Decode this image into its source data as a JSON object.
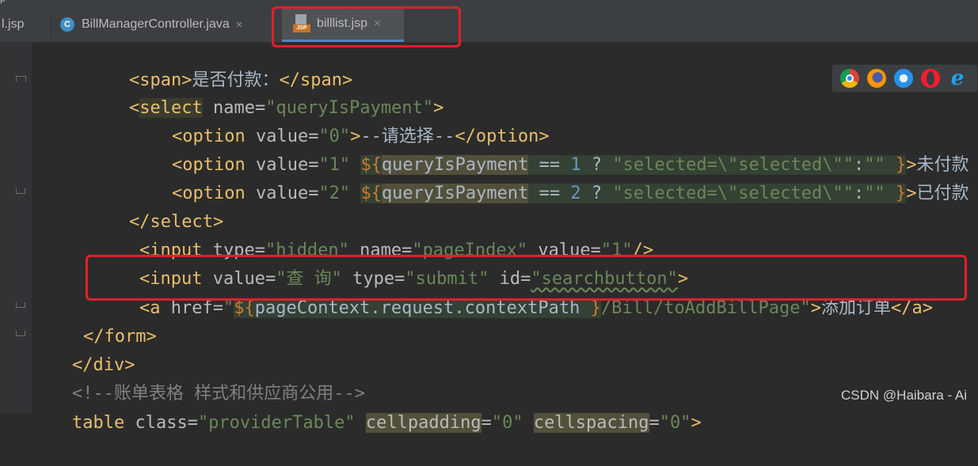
{
  "window": {
    "top_strip_text": "p"
  },
  "tabs": [
    {
      "label": "l.jsp",
      "icon": "jsp-file-icon",
      "active": false
    },
    {
      "label": "BillManagerController.java",
      "icon": "java-class-icon",
      "icon_letter": "C",
      "active": false
    },
    {
      "label": "billlist.jsp",
      "icon": "jsp-file-icon",
      "icon_badge": "JSP",
      "active": true
    }
  ],
  "close_glyph": "×",
  "browser_icons": [
    "chrome-icon",
    "firefox-icon",
    "safari-icon",
    "opera-icon",
    "ie-icon"
  ],
  "code": {
    "l1": {
      "open": "<span>",
      "text": "是否付款：",
      "close": "</span>"
    },
    "l2": {
      "lt": "<",
      "tag": "select",
      "attr": " name=",
      "val": "\"queryIsPayment\"",
      "gt": ">"
    },
    "l3": {
      "lt": "<",
      "tag": "option",
      "attr": " value=",
      "val": "\"0\"",
      "gt": ">",
      "text": "--请选择--",
      "close": "</option>"
    },
    "l4": {
      "lt": "<",
      "tag": "option",
      "attr": " value=",
      "val": "\"1\"",
      "sp": " ",
      "el_open": "${",
      "var": "queryIsPayment",
      "op": " == ",
      "num": "1",
      "q": " ? ",
      "s1": "\"selected=\\\"selected\\\"\"",
      "colon": ":",
      "s2": "\"\"",
      "el_close": " }",
      "gt": ">",
      "text": "未付款"
    },
    "l5": {
      "lt": "<",
      "tag": "option",
      "attr": " value=",
      "val": "\"2\"",
      "sp": " ",
      "el_open": "${",
      "var": "queryIsPayment",
      "op": " == ",
      "num": "2",
      "q": " ? ",
      "s1": "\"selected=\\\"selected\\\"\"",
      "colon": ":",
      "s2": "\"\"",
      "el_close": " }",
      "gt": ">",
      "text": "已付款"
    },
    "l6": {
      "close": "</select>"
    },
    "l7": {
      "lt": "<",
      "tag": "input",
      "a1": " type=",
      "v1": "\"hidden\"",
      "a2": " name=",
      "v2": "\"pageIndex\"",
      "a3": " value=",
      "v3": "\"1\"",
      "gt": "/>"
    },
    "l8": {
      "lt": "<",
      "tag": "input",
      "a1": " value=",
      "v1": "\"查 询\"",
      "a2": " type=",
      "v2": "\"submit\"",
      "a3": " id=",
      "v3": "\"searchbutton\"",
      "gt": ">"
    },
    "l9": {
      "lt": "<",
      "tag": "a",
      "a1": " href=",
      "q1": "\"",
      "el_open": "${",
      "expr": "pageContext.request.contextPath",
      "el_close": " }",
      "path": "/Bill/toAddBillPage\"",
      "gt": ">",
      "text": "添加订单",
      "close": "</a>"
    },
    "l10": {
      "close": "</form>"
    },
    "l11": {
      "close": "</div>"
    },
    "l12": {
      "comment": "<!--账单表格 样式和供应商公用-->"
    },
    "l13": {
      "tag": "table",
      "a1": " class=",
      "v1": "\"providerTable\"",
      "sp": " ",
      "a2": "cellpadding",
      "eq2": "=",
      "v2": "\"0\"",
      "sp2": " ",
      "a3": "cellspacing",
      "eq3": "=",
      "v3": "\"0\"",
      "gt": ">"
    }
  },
  "watermark": "CSDN @Haibara - Ai"
}
